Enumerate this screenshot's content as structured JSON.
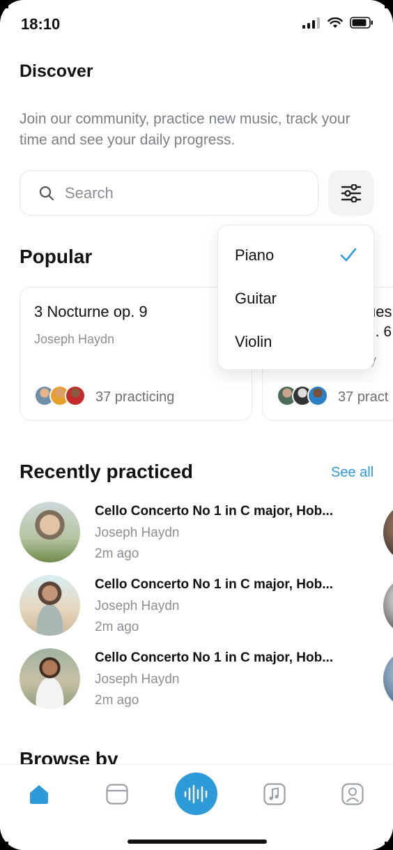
{
  "status_bar": {
    "time": "18:10"
  },
  "discover": {
    "title": "Discover",
    "subtitle": "Join our community, practice new music, track your time and see your daily progress."
  },
  "search": {
    "placeholder": "Search",
    "value": ""
  },
  "popular": {
    "title": "Popular",
    "cards": [
      {
        "title": "3 Nocturne op. 9",
        "author": "Joseph Haydn",
        "count": "37 practicing"
      },
      {
        "title": "ues",
        "title2": "... 6",
        "author": "y",
        "count": "37 pract"
      }
    ]
  },
  "filter_dropdown": {
    "options": [
      "Piano",
      "Guitar",
      "Violin"
    ],
    "selected": "Piano"
  },
  "recently_practiced": {
    "title": "Recently practiced",
    "see_all": "See all",
    "items": [
      {
        "title": "Cello Concerto No 1 in C major, Hob...",
        "author": "Joseph Haydn",
        "time": "2m ago"
      },
      {
        "title": "Cello Concerto No 1 in C major, Hob...",
        "author": "Joseph Haydn",
        "time": "2m ago"
      },
      {
        "title": "Cello Concerto No 1 in C major, Hob...",
        "author": "Joseph Haydn",
        "time": "2m ago"
      }
    ]
  },
  "browse": {
    "title": "Browse by"
  },
  "tabbar": {
    "tabs": [
      "home-icon",
      "library-icon",
      "record-icon",
      "music-note-icon",
      "profile-icon"
    ],
    "active": "home-icon"
  },
  "colors": {
    "accent": "#2e9ad8",
    "text": "#111111",
    "muted": "#8a8f95"
  }
}
